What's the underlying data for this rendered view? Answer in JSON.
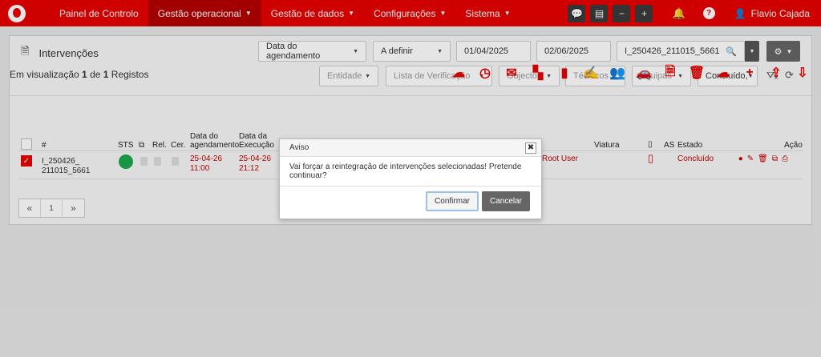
{
  "nav": {
    "items": [
      {
        "label": "Painel de Controlo",
        "caret": false,
        "active": false
      },
      {
        "label": "Gestão operacional",
        "caret": true,
        "active": true
      },
      {
        "label": "Gestão de dados",
        "caret": true,
        "active": false
      },
      {
        "label": "Configurações",
        "caret": true,
        "active": false
      },
      {
        "label": "Sistema",
        "caret": true,
        "active": false
      }
    ],
    "user_name": "Flavio Cajada"
  },
  "panel": {
    "title": "Intervenções",
    "filters": {
      "date_type": "Data do agendamento",
      "status_define": "A definir",
      "date_from": "01/04/2025",
      "date_to": "02/06/2025",
      "search_value": "I_250426_211015_5661",
      "entidade": "Entidade",
      "lista": "Lista de Verificação",
      "objecto": "Objecto",
      "tecnicos": "Técnicos",
      "equipas": "Equipas",
      "estado": "Concluído,"
    },
    "view_prefix": "Em visualização ",
    "view_page": "1",
    "view_mid": " de ",
    "view_total": "1",
    "view_suffix": " Registos"
  },
  "table": {
    "headers": {
      "num": "#",
      "sts": "STS",
      "rel": "Rel.",
      "cer": "Cer.",
      "data_agend_1": "Data do",
      "data_agend_2": "agendamento",
      "data_exec_1": "Data da",
      "data_exec_2": "Execução",
      "viatura": "Viatura",
      "as": "AS",
      "estado": "Estado",
      "acao": "Ação"
    },
    "row": {
      "id_1": "I_250426_",
      "id_2": "211015_5661",
      "agend_date": "25-04-26",
      "agend_time": "11:00",
      "exec_date": "25-04-26",
      "exec_time": "21:12",
      "user": "Root User",
      "estado": "Concluído"
    }
  },
  "pager": {
    "prev": "«",
    "page": "1",
    "next": "»"
  },
  "modal": {
    "title": "Aviso",
    "message": "Vai forçar a reintegração de intervenções selecionadas! Pretende continuar?",
    "confirm": "Confirmar",
    "cancel": "Cancelar"
  },
  "colors": {
    "brand": "#e60000",
    "success": "#1aa84c"
  }
}
